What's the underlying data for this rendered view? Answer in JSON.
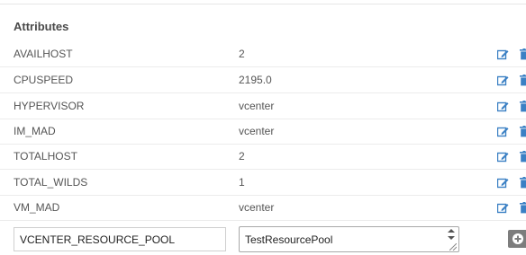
{
  "section": {
    "title": "Attributes"
  },
  "attributes": [
    {
      "key": "AVAILHOST",
      "value": "2"
    },
    {
      "key": "CPUSPEED",
      "value": "2195.0"
    },
    {
      "key": "HYPERVISOR",
      "value": "vcenter"
    },
    {
      "key": "IM_MAD",
      "value": "vcenter"
    },
    {
      "key": "TOTALHOST",
      "value": "2"
    },
    {
      "key": "TOTAL_WILDS",
      "value": "1"
    },
    {
      "key": "VM_MAD",
      "value": "vcenter"
    }
  ],
  "new_attribute": {
    "key": "VCENTER_RESOURCE_POOL",
    "value": "TestResourcePool"
  },
  "icons": {
    "edit": "edit-icon",
    "delete": "trash-icon",
    "add": "plus-circle-icon"
  },
  "colors": {
    "icon_accent": "#3b80c4",
    "add_button": "#7d7d7d"
  }
}
